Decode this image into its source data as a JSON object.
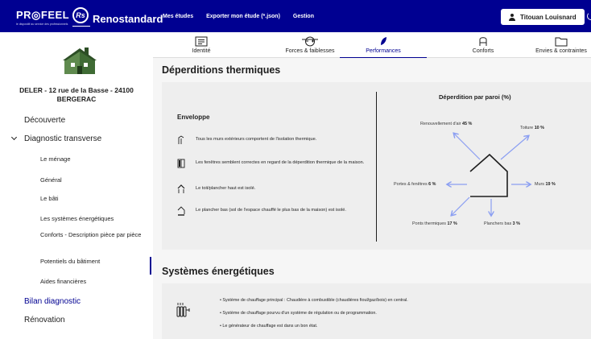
{
  "header": {
    "brand_main": "PR◎FEEL",
    "brand_tagline": "le dispositif au service des professionnels",
    "brand_badge": "Rs",
    "brand_product": "Renostandard",
    "nav": [
      "Mes études",
      "Exporter mon étude (*.json)",
      "Gestion"
    ],
    "user_name": "Titouan Louisnard"
  },
  "sidebar": {
    "address": "DELER - 12 rue de la Basse - 24100 BERGERAC",
    "items": [
      {
        "label": "Découverte"
      },
      {
        "label": "Diagnostic transverse"
      },
      {
        "label": "Le ménage"
      },
      {
        "label": "Général"
      },
      {
        "label": "Le bâti"
      },
      {
        "label": "Les systèmes énergétiques"
      },
      {
        "label": "Conforts - Description pièce par pièce"
      },
      {
        "label": "Potentiels du bâtiment"
      },
      {
        "label": "Aides financières"
      },
      {
        "label": "Bilan diagnostic"
      },
      {
        "label": "Rénovation"
      }
    ]
  },
  "tabs": [
    {
      "label": "Identité",
      "icon": "id-card-icon"
    },
    {
      "label": "Forces & faiblesses",
      "icon": "balance-icon"
    },
    {
      "label": "Performances",
      "icon": "leaf-icon"
    },
    {
      "label": "Conforts",
      "icon": "armchair-icon"
    },
    {
      "label": "Envies & contraintes",
      "icon": "folder-icon"
    }
  ],
  "deperditions": {
    "title": "Déperditions thermiques",
    "envelope_title": "Enveloppe",
    "envelope_items": [
      "Tous les murs extérieurs comportent de l'isolation thermique.",
      "Les fenêtres semblent correctes en regard de la déperdition thermique de la maison.",
      "Le toit/plancher haut est isolé.",
      "Le plancher bas (sol de l'espace chauffé le plus bas de la maison) est isolé."
    ],
    "chart_title": "Déperdition par paroi (%)",
    "chart": [
      {
        "name": "Renouvellement d'air",
        "value": "45 %"
      },
      {
        "name": "Toiture",
        "value": "10 %"
      },
      {
        "name": "Portes & fenêtres",
        "value": "6 %"
      },
      {
        "name": "Murs",
        "value": "19 %"
      },
      {
        "name": "Ponts thermiques",
        "value": "17 %"
      },
      {
        "name": "Planchers bas",
        "value": "3 %"
      }
    ]
  },
  "systemes": {
    "title": "Systèmes énergétiques",
    "items": [
      "• Système de chauffage principal : Chaudière à combustible (chaudières fioul/gaz/bois) en central.",
      "• Système de chauffage pourvu d'un système de régulation ou de programmation.",
      "• Le générateur de chauffage est dans un bon état."
    ]
  },
  "colors": {
    "primary": "#000091",
    "arrow": "#8a9ef2",
    "content_bg": "#f6f6f6",
    "card_bg": "#eeeeee"
  }
}
